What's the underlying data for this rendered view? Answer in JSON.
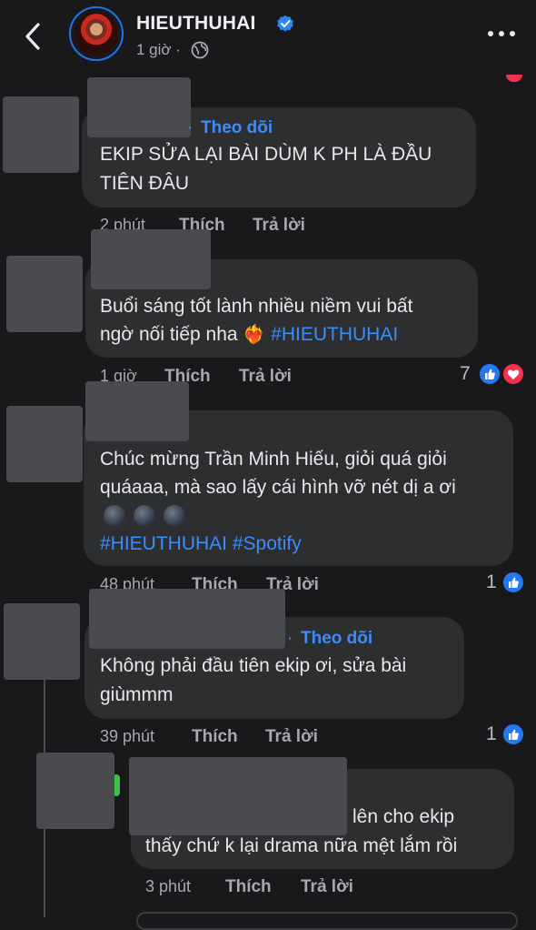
{
  "header": {
    "name": "HIEUTHUHAI",
    "timestamp": "1 giờ ·"
  },
  "comments": [
    {
      "follow_label": "Theo dõi",
      "text_line1": "EKIP SỬA LẠI BÀI DÙM K PH LÀ ĐẦU",
      "text_line2": "TIÊN ĐÂU",
      "time": "2 phút",
      "like_label": "Thích",
      "reply_label": "Trả lời"
    },
    {
      "text_line1": "Buổi sáng tốt lành nhiều niềm vui bất",
      "text_line2_prefix": "ngờ nối tiếp nha",
      "text_emoji": "❤️‍🔥",
      "hashtag": "#HIEUTHUHAI",
      "time": "1 giờ",
      "like_label": "Thích",
      "reply_label": "Trả lời",
      "reaction_count": "7"
    },
    {
      "text_line1": "Chúc mừng Trần Minh Hiếu, giỏi quá giỏi",
      "text_line2": "quáaaa, mà sao lấy cái hình vỡ nét dị a ơi",
      "hashtags": "#HIEUTHUHAI #Spotify",
      "time": "48 phút",
      "like_label": "Thích",
      "reply_label": "Trả lời",
      "reaction_count": "1"
    },
    {
      "follow_label": "Theo dõi",
      "text_line1": "Không phải đầu tiên ekip ơi, sửa bài",
      "text_line2": "giùmmm",
      "time": "39 phút",
      "like_label": "Thích",
      "reply_label": "Trả lời",
      "reaction_count": "1"
    },
    {
      "text_line1": "lên cho ekip",
      "text_line2": "thấy chứ k lại drama nữa mệt lắm rồi",
      "time": "3 phút",
      "like_label": "Thích",
      "reply_label": "Trả lời"
    }
  ]
}
